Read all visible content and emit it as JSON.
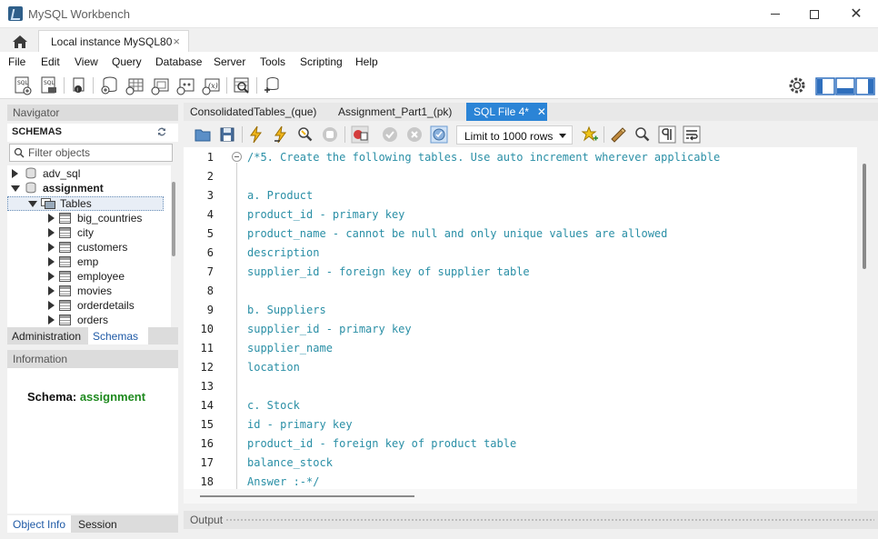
{
  "window": {
    "title": "MySQL Workbench",
    "connection_tab": "Local instance MySQL80",
    "close_glyph": "×"
  },
  "menu": [
    "File",
    "Edit",
    "View",
    "Query",
    "Database",
    "Server",
    "Tools",
    "Scripting",
    "Help"
  ],
  "navigator": {
    "header": "Navigator",
    "schemas_label": "SCHEMAS",
    "filter_placeholder": "Filter objects",
    "schemas": [
      {
        "name": "adv_sql",
        "expanded": false,
        "bold": false
      },
      {
        "name": "assignment",
        "expanded": true,
        "bold": true
      }
    ],
    "tables_node": "Tables",
    "tables": [
      "big_countries",
      "city",
      "customers",
      "emp",
      "employee",
      "movies",
      "orderdetails",
      "orders"
    ],
    "tabs": [
      "Administration",
      "Schemas"
    ],
    "active_tab": "Schemas"
  },
  "information": {
    "header": "Information",
    "schema_label": "Schema:",
    "schema_value": "assignment",
    "tabs": [
      "Object Info",
      "Session"
    ]
  },
  "editor": {
    "tabs": [
      {
        "label": "ConsolidatedTables_(que)",
        "active": false
      },
      {
        "label": "Assignment_Part1_(pk)",
        "active": false
      },
      {
        "label": "SQL File 4*",
        "active": true
      }
    ],
    "limit_rows": "Limit to 1000 rows",
    "lines": [
      "/*5. Create the following tables. Use auto increment wherever applicable",
      "",
      "a. Product",
      "product_id - primary key",
      "product_name - cannot be null and only unique values are allowed",
      "description",
      "supplier_id - foreign key of supplier table",
      "",
      "b. Suppliers",
      "supplier_id - primary key",
      "supplier_name",
      "location",
      "",
      "c. Stock",
      "id - primary key",
      "product_id - foreign key of product table",
      "balance_stock",
      "Answer :-*/"
    ],
    "line_numbers": [
      "1",
      "2",
      "3",
      "4",
      "5",
      "6",
      "7",
      "8",
      "9",
      "10",
      "11",
      "12",
      "13",
      "14",
      "15",
      "16",
      "17",
      "18"
    ]
  },
  "output": {
    "label": "Output"
  },
  "colors": {
    "active_tab": "#2b84d6",
    "comment_text": "#2a8fa6",
    "schema_value": "#1f8a1f"
  }
}
